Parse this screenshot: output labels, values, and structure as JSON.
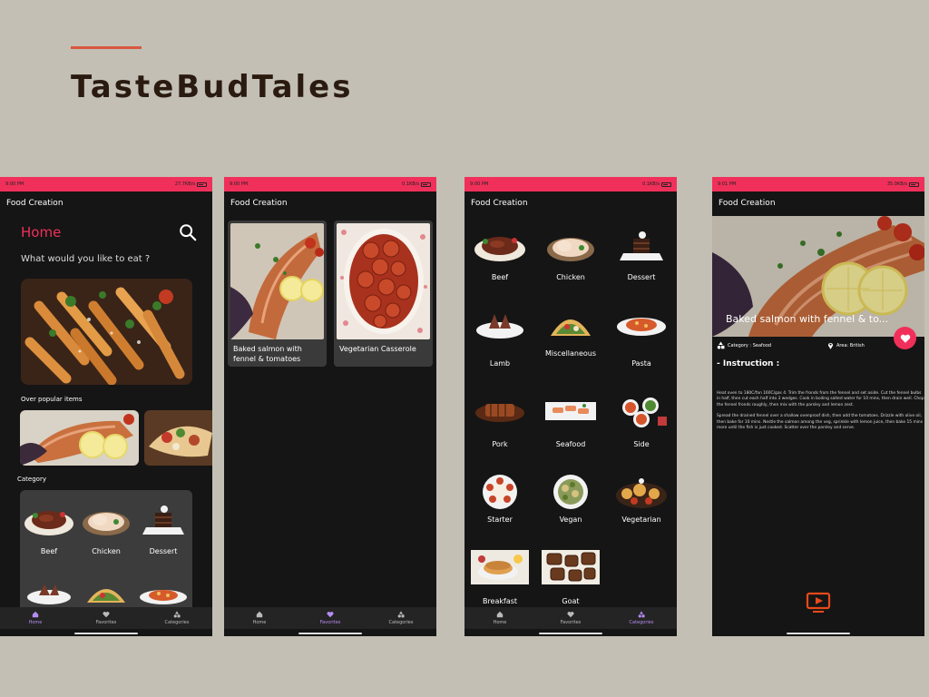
{
  "brand": {
    "title": "TasteBudTales"
  },
  "colors": {
    "background": "#c3bfb4",
    "accent": "#f0305a",
    "nav_active": "#b58cf2",
    "line": "#d9573f"
  },
  "status_bars": [
    {
      "time": "9:00 PM",
      "network": "27.7KB/s"
    },
    {
      "time": "9:00 PM",
      "network": "0.1KB/s"
    },
    {
      "time": "9:00 PM",
      "network": "0.1KB/s"
    },
    {
      "time": "9:01 PM",
      "network": "35.0KB/s"
    }
  ],
  "app_bar_title": "Food Creation",
  "home": {
    "heading": "Home",
    "question": "What would you like to eat ?",
    "popular_label": "Over popular items",
    "category_label": "Category",
    "categories": [
      "Beef",
      "Chicken",
      "Dessert"
    ]
  },
  "favorites": {
    "items": [
      {
        "title": "Baked salmon with fennel & tomatoes"
      },
      {
        "title": "Vegetarian Casserole"
      }
    ]
  },
  "categories_grid": [
    "Beef",
    "Chicken",
    "Dessert",
    "Lamb",
    "Miscellaneous",
    "Pasta",
    "Pork",
    "Seafood",
    "Side",
    "Starter",
    "Vegan",
    "Vegetarian",
    "Breakfast",
    "Goat"
  ],
  "detail": {
    "title": "Baked salmon with fennel & to...",
    "category": "Category : Seafood",
    "area": "Area: British",
    "instruction_label": "- Instruction :",
    "instructions": [
      "Heat oven to 180C/fan 160C/gas 4. Trim the fronds from the fennel and set aside. Cut the fennel bulbs in half, then cut each half into 3 wedges. Cook in boiling salted water for 10 mins, then drain well. Chop the fennel fronds roughly, then mix with the parsley and lemon zest.",
      "Spread the drained fennel over a shallow ovenproof dish, then add the tomatoes. Drizzle with olive oil, then bake for 10 mins. Nestle the salmon among the veg, sprinkle with lemon juice, then bake 15 mins more until the fish is just cooked. Scatter over the parsley and serve."
    ]
  },
  "nav": {
    "home": "Home",
    "favorites": "Favorites",
    "categories": "Categories"
  }
}
